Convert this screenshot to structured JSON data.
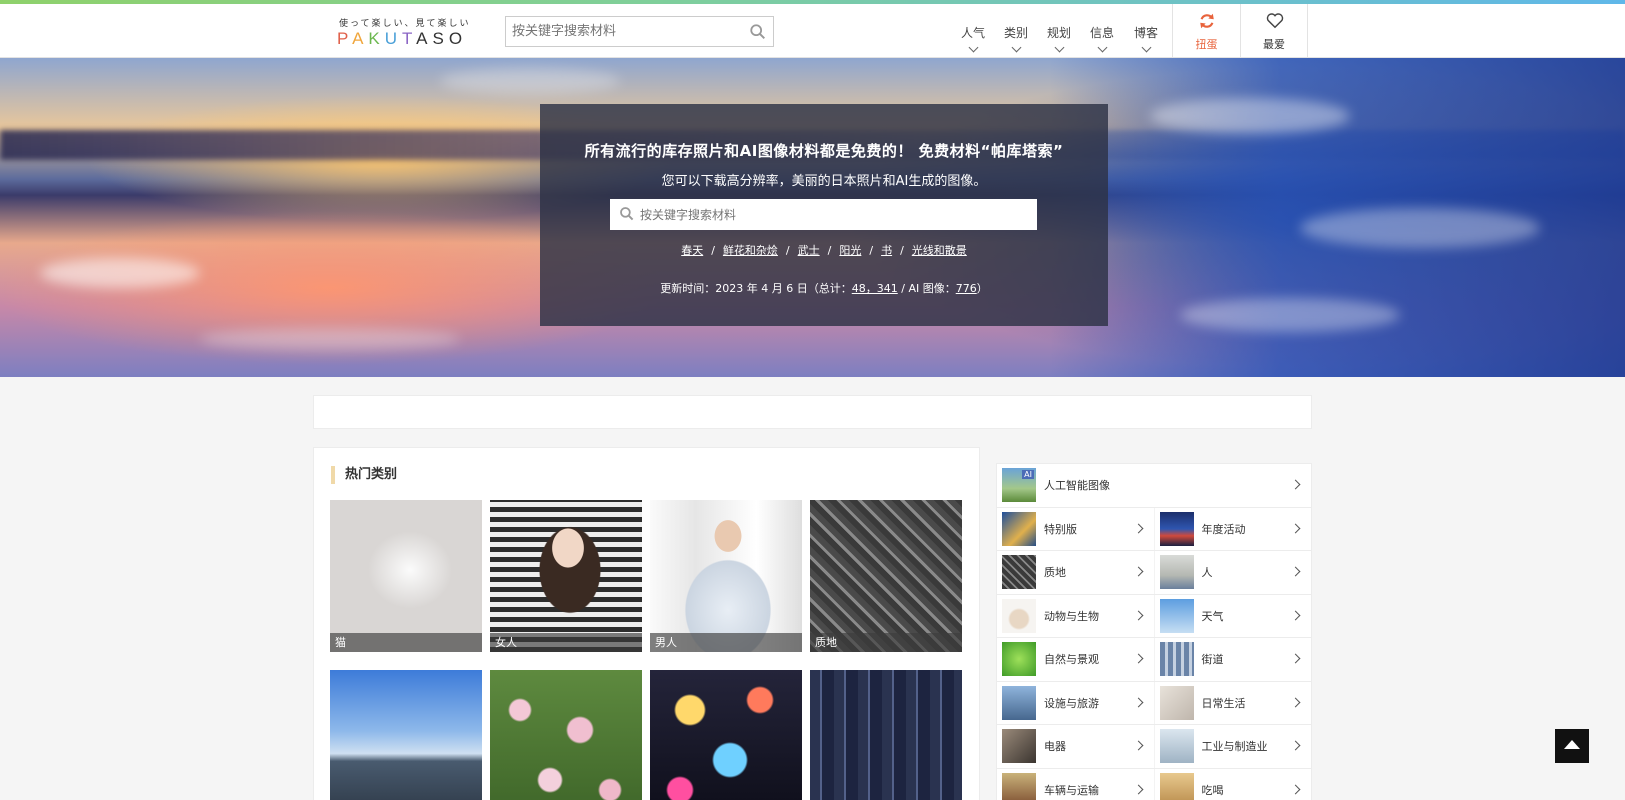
{
  "header": {
    "logo_tagline": "使って楽しい、見て楽しい",
    "logo_word": [
      "P",
      "A",
      "K",
      "U",
      "T",
      "A",
      "S",
      "O"
    ],
    "search": {
      "placeholder": "按关键字搜索材料",
      "value": ""
    },
    "nav": [
      {
        "label": "人气"
      },
      {
        "label": "类别"
      },
      {
        "label": "规划"
      },
      {
        "label": "信息"
      },
      {
        "label": "博客"
      }
    ],
    "shuffle_label": "扭蛋",
    "favorite_label": "最爱",
    "accent_color": "#e8633c"
  },
  "hero": {
    "title": "所有流行的库存照片和AI图像材料都是免费的！ 免费材料“帕库塔索”",
    "subtitle": "您可以下载高分辨率，美丽的日本照片和AI生成的图像。",
    "search": {
      "placeholder": "按关键字搜索材料",
      "value": ""
    },
    "tags": [
      "春天",
      "鲜花和杂烩",
      "武士",
      "阳光",
      "书",
      "光线和散景"
    ],
    "update_prefix": "更新时间：2023 年 4 月 6 日（总计：",
    "total_count": "48，341",
    "ai_label": " / AI 图像：",
    "ai_count": "776",
    "update_suffix": "）"
  },
  "popular": {
    "heading": "热门类别",
    "tiles": [
      {
        "caption": "猫"
      },
      {
        "caption": "女人"
      },
      {
        "caption": "男人"
      },
      {
        "caption": "质地"
      },
      {
        "caption": ""
      },
      {
        "caption": ""
      },
      {
        "caption": ""
      },
      {
        "caption": ""
      }
    ]
  },
  "categories": {
    "single": {
      "label": "人工智能图像",
      "badge": "AI"
    },
    "pairs": [
      [
        "特别版",
        "年度活动"
      ],
      [
        "质地",
        "人"
      ],
      [
        "动物与生物",
        "天气"
      ],
      [
        "自然与景观",
        "街道"
      ],
      [
        "设施与旅游",
        "日常生活"
      ],
      [
        "电器",
        "工业与制造业"
      ],
      [
        "车辆与运输",
        "吃喝"
      ]
    ]
  }
}
